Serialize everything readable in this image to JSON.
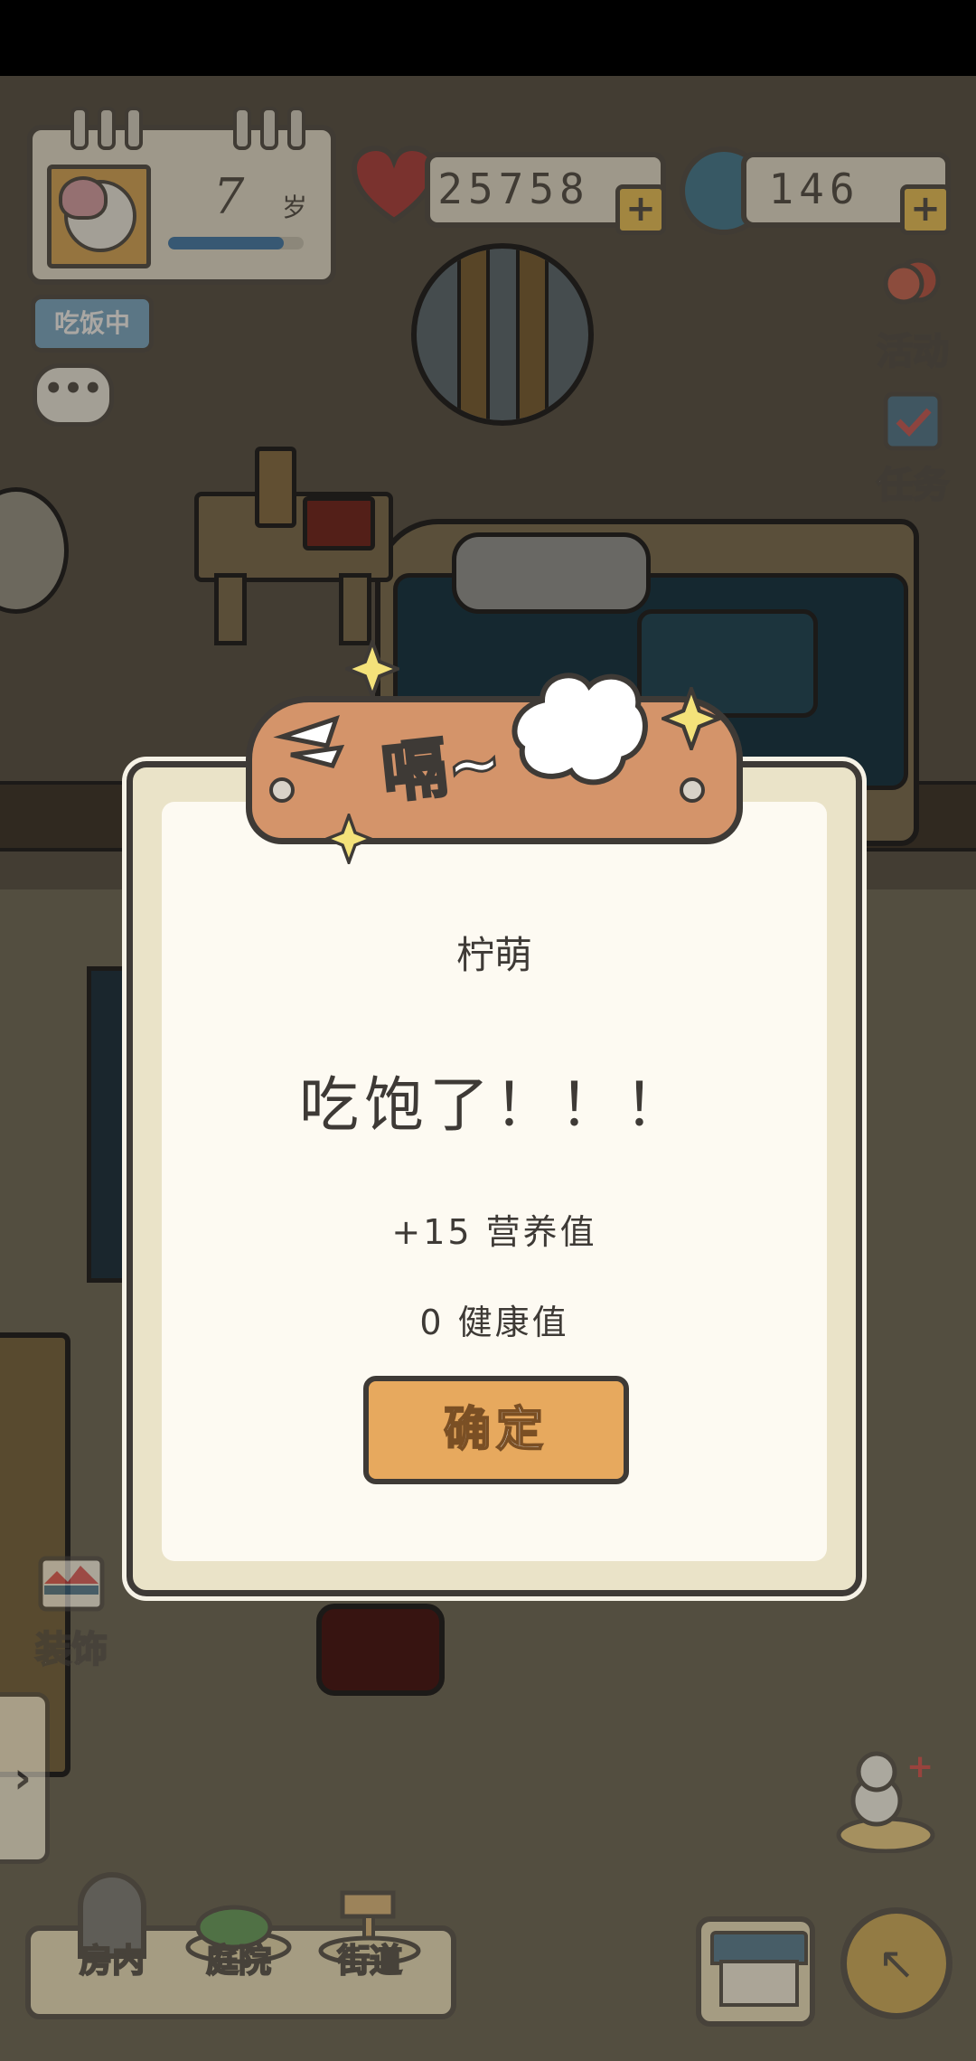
{
  "hud": {
    "age_value": "7",
    "age_unit": "岁",
    "age_progress": 0.85,
    "hearts": "25758",
    "coins": "146",
    "plus": "+",
    "status": "吃饭中",
    "chat": "•••"
  },
  "side": {
    "activity_label": "活动",
    "task_label": "任务",
    "decor_label": "装饰",
    "expand": "›"
  },
  "dialog": {
    "banner": "嗝~",
    "pet_name": "柠萌",
    "message": "吃饱了！！！",
    "nutrition": "+15 营养值",
    "health": "0 健康值",
    "confirm": "确定"
  },
  "nav": {
    "indoor": "房内",
    "yard": "庭院",
    "street": "街道"
  },
  "colors": {
    "accent": "#e7a95e",
    "outline": "#3e3a36",
    "card": "#fdfaf2"
  }
}
